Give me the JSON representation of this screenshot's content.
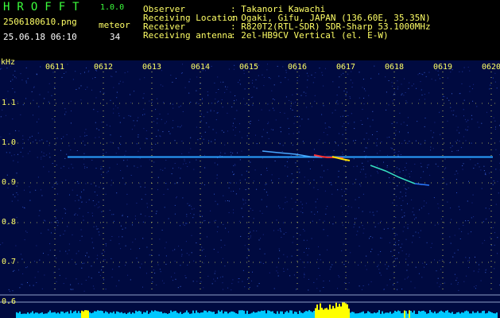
{
  "header": {
    "app_title": "HROFFT",
    "version": "1.0.0",
    "filename": "2506180610.png",
    "datetime": "25.06.18 06:10",
    "meteor_label": "meteor",
    "meteor_count": "34",
    "info": [
      {
        "label": "Observer",
        "value": ": Takanori Kawachi"
      },
      {
        "label": "Receiving Location",
        "value": ": Ogaki, Gifu, JAPAN (136.60E, 35.35N)"
      },
      {
        "label": "Receiver",
        "value": ": R820T2(RTL-SDR) SDR-Sharp 53.1000MHz"
      },
      {
        "label": "Receiving antenna",
        "value": ": 2el-HB9CV Vertical (el. E-W)"
      }
    ]
  },
  "spectrogram": {
    "y_unit": "kHz",
    "x_ticks": [
      "0611",
      "0612",
      "0613",
      "0614",
      "0615",
      "0616",
      "0617",
      "0618",
      "0619",
      "0620"
    ],
    "y_ticks": [
      "1.1",
      "1.0",
      "0.9",
      "0.8",
      "0.7",
      "0.6"
    ],
    "y_range_khz": [
      0.58,
      1.2
    ],
    "carrier_khz": 0.965,
    "background_color": "#000a40",
    "carrier_color": "#2aa0ff",
    "level_color": "#00c8ff",
    "meteor_highlight_color": "#ffff00"
  }
}
